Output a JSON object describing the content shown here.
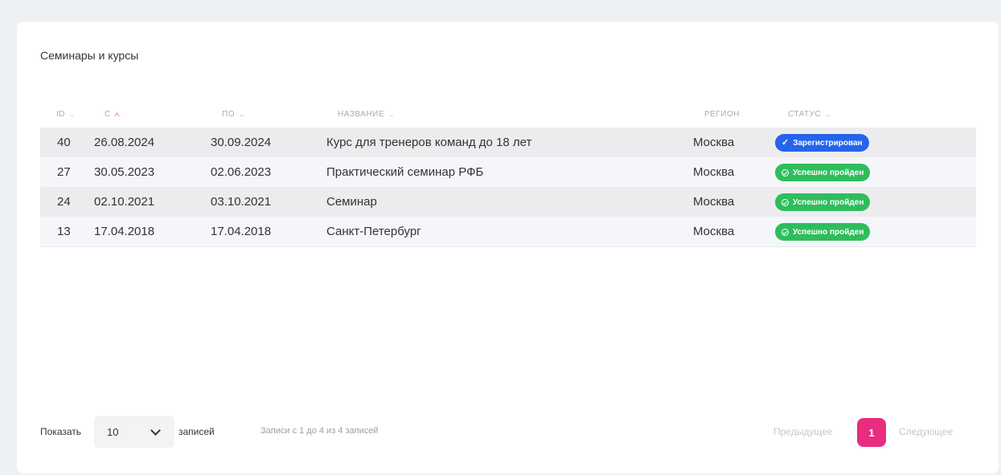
{
  "card": {
    "title": "Семинары и курсы"
  },
  "table": {
    "columns": [
      {
        "label": "ID",
        "sort": "none"
      },
      {
        "label": "С",
        "sort": "asc"
      },
      {
        "label": "ПО",
        "sort": "none"
      },
      {
        "label": "НАЗВАНИЕ",
        "sort": "none"
      },
      {
        "label": "РЕГИОН",
        "sort": "disabled"
      },
      {
        "label": "СТАТУС",
        "sort": "none"
      }
    ],
    "rows": [
      {
        "id": "40",
        "from": "26.08.2024",
        "to": "30.09.2024",
        "name": "Курс для тренеров команд до 18 лет",
        "region": "Москва",
        "status": "Зарегистрирован",
        "status_type": "registered",
        "status_icon": "check-icon"
      },
      {
        "id": "27",
        "from": "30.05.2023",
        "to": "02.06.2023",
        "name": "Практический семинар РФБ",
        "region": "Москва",
        "status": "Успешно пройден",
        "status_type": "passed",
        "status_icon": "check-circle-icon"
      },
      {
        "id": "24",
        "from": "02.10.2021",
        "to": "03.10.2021",
        "name": "Семинар",
        "region": "Москва",
        "status": "Успешно пройден",
        "status_type": "passed",
        "status_icon": "check-circle-icon"
      },
      {
        "id": "13",
        "from": "17.04.2018",
        "to": "17.04.2018",
        "name": "Санкт-Петербург",
        "region": "Москва",
        "status": "Успешно пройден",
        "status_type": "passed",
        "status_icon": "check-circle-icon"
      }
    ]
  },
  "footer": {
    "show_label": "Показать",
    "page_size": "10",
    "entries_label": "записей",
    "info": "Записи с 1 до 4 из 4 записей",
    "prev_label": "Предыдущее",
    "current_page": "1",
    "next_label": "Следующее"
  },
  "colors": {
    "registered": "#2563eb",
    "passed": "#2ebd5c",
    "active_page": "#ea2c80",
    "sort_active": "#f27a93"
  }
}
